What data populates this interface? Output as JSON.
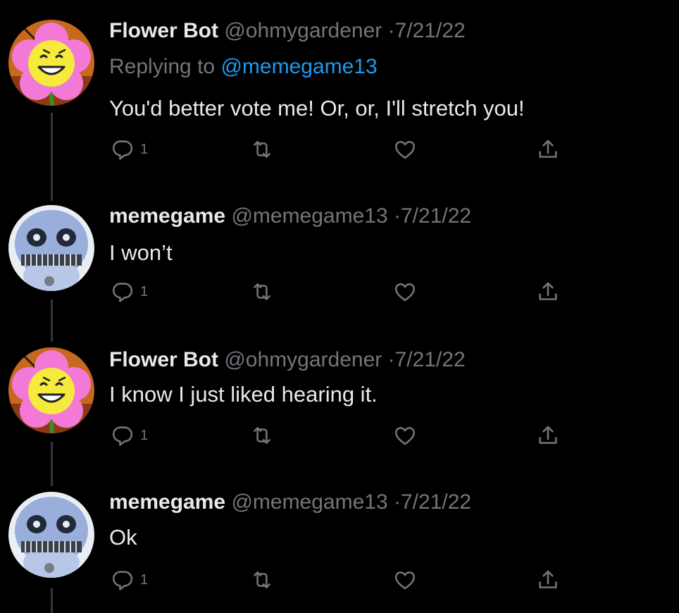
{
  "colors": {
    "background": "#000000",
    "primary_text": "#e7e9ea",
    "secondary_text": "#71767b",
    "link": "#1d9bf0",
    "thread_line": "#333639"
  },
  "icons": {
    "reply": "reply-icon",
    "retweet": "retweet-icon",
    "like": "heart-icon",
    "share": "share-icon"
  },
  "tweets": [
    {
      "display_name": "Flower Bot",
      "handle": "@ohmygardener",
      "dot": "·",
      "date": "7/21/22",
      "replying_prefix": "Replying to",
      "replying_to": "@memegame13",
      "text": "You'd better vote me! Or, or, I'll stretch you!",
      "reply_count": "1"
    },
    {
      "display_name": "memegame",
      "handle": "@memegame13",
      "dot": "·",
      "date": "7/21/22",
      "text": "I won’t",
      "reply_count": "1"
    },
    {
      "display_name": "Flower Bot",
      "handle": "@ohmygardener",
      "dot": "·",
      "date": "7/21/22",
      "text": "I know I just liked hearing it.",
      "reply_count": "1"
    },
    {
      "display_name": "memegame",
      "handle": "@memegame13",
      "dot": "·",
      "date": "7/21/22",
      "text": "Ok",
      "reply_count": "1"
    }
  ]
}
